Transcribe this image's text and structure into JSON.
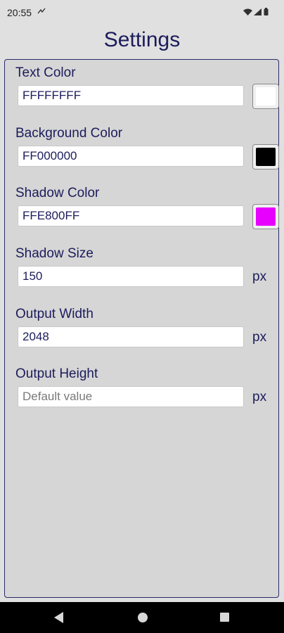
{
  "status_bar": {
    "time": "20:55",
    "icons": [
      "data-saver-icon",
      "wifi-icon",
      "signal-icon",
      "battery-icon"
    ]
  },
  "title": "Settings",
  "fields": [
    {
      "label": "Text Color",
      "value": "FFFFFFFF",
      "placeholder": "",
      "swatch_color": "#ffffff"
    },
    {
      "label": "Background Color",
      "value": "FF000000",
      "placeholder": "",
      "swatch_color": "#000000"
    },
    {
      "label": "Shadow Color",
      "value": "FFE800FF",
      "placeholder": "",
      "swatch_color": "#e800ff"
    },
    {
      "label": "Shadow Size",
      "value": "150",
      "placeholder": "",
      "unit": "px"
    },
    {
      "label": "Output Width",
      "value": "2048",
      "placeholder": "",
      "unit": "px"
    },
    {
      "label": "Output Height",
      "value": "",
      "placeholder": "Default value",
      "unit": "px"
    }
  ],
  "colors": {
    "accent_text": "#1c1c5c",
    "panel_bg": "#d6d6d6",
    "screen_bg": "#e0e0e0"
  },
  "nav_bar": {
    "icons": [
      "back-icon",
      "home-icon",
      "recents-icon"
    ]
  }
}
